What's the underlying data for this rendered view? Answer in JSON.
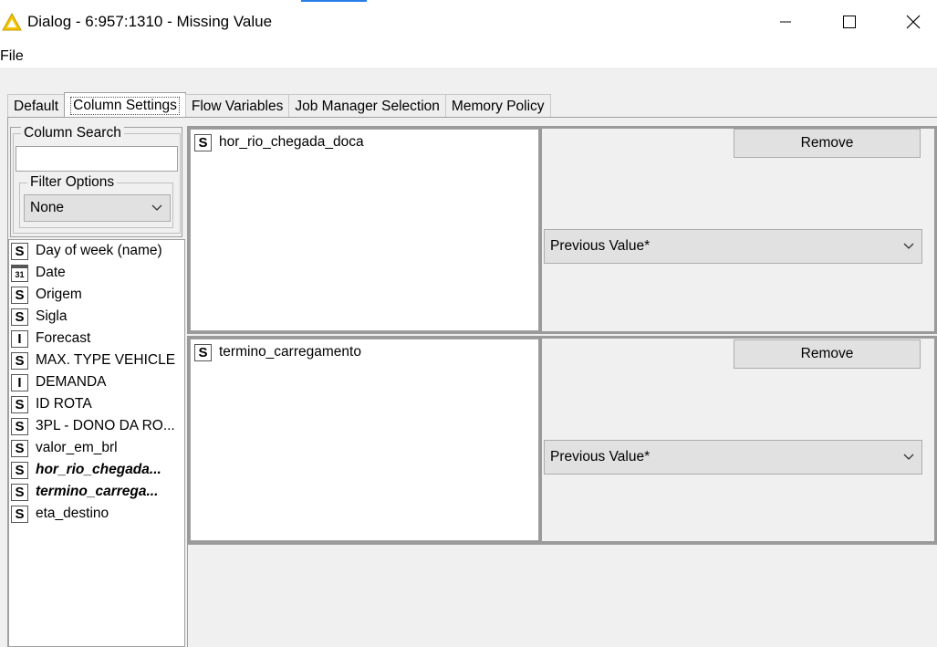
{
  "window": {
    "title": "Dialog - 6:957:1310 - Missing Value",
    "icon": "warning-triangle-icon"
  },
  "menu": {
    "file": "File"
  },
  "tabs": [
    "Default",
    "Column Settings",
    "Flow Variables",
    "Job Manager Selection",
    "Memory Policy"
  ],
  "active_tab": "Column Settings",
  "column_search": {
    "legend": "Column Search",
    "value": "",
    "filter_options": {
      "legend": "Filter Options",
      "selected": "None"
    }
  },
  "columns": [
    {
      "type": "S",
      "name": "Day of week (name)",
      "bold": false
    },
    {
      "type": "31",
      "name": "Date",
      "bold": false
    },
    {
      "type": "S",
      "name": "Origem",
      "bold": false
    },
    {
      "type": "S",
      "name": "Sigla",
      "bold": false
    },
    {
      "type": "I",
      "name": "Forecast",
      "bold": false
    },
    {
      "type": "S",
      "name": "MAX. TYPE VEHICLE",
      "bold": false
    },
    {
      "type": "I",
      "name": "DEMANDA",
      "bold": false
    },
    {
      "type": "S",
      "name": "ID ROTA",
      "bold": false
    },
    {
      "type": "S",
      "name": "3PL - DONO DA RO...",
      "bold": false
    },
    {
      "type": "S",
      "name": "valor_em_brl",
      "bold": false
    },
    {
      "type": "S",
      "name": "hor_rio_chegada...",
      "bold": true
    },
    {
      "type": "S",
      "name": "termino_carrega...",
      "bold": true
    },
    {
      "type": "S",
      "name": "eta_destino",
      "bold": false
    }
  ],
  "settings": [
    {
      "column_type": "S",
      "column": "hor_rio_chegada_doca",
      "remove_label": "Remove",
      "method": "Previous Value*"
    },
    {
      "column_type": "S",
      "column": "termino_carregamento",
      "remove_label": "Remove",
      "method": "Previous Value*"
    }
  ]
}
